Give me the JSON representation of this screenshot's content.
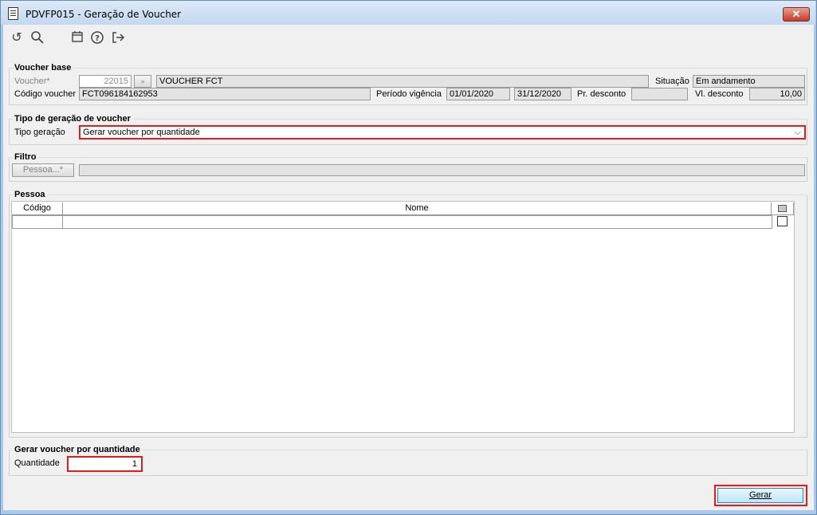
{
  "window": {
    "title": "PDVFP015 - Geração de Voucher",
    "close_label": "✕"
  },
  "toolbar": {
    "icons": [
      "refresh-icon",
      "search-icon",
      "calendar-icon",
      "help-icon",
      "exit-icon"
    ]
  },
  "voucher_base": {
    "title": "Voucher base",
    "voucher_label": "Voucher*",
    "voucher_value": "22015",
    "voucher_desc": "VOUCHER FCT",
    "situacao_label": "Situação",
    "situacao_value": "Em andamento",
    "codigo_label": "Código voucher",
    "codigo_value": "FCT096184162953",
    "periodo_label": "Período vigência",
    "periodo_inicio": "01/01/2020",
    "periodo_fim": "31/12/2020",
    "pr_desconto_label": "Pr. desconto",
    "pr_desconto_value": "",
    "vl_desconto_label": "Vl. desconto",
    "vl_desconto_value": "10,00"
  },
  "tipo_geracao": {
    "title": "Tipo de geração de voucher",
    "label": "Tipo geração",
    "selected": "Gerar voucher por quantidade"
  },
  "filtro": {
    "title": "Filtro",
    "pessoa_button": "Pessoa...*",
    "pessoa_value": ""
  },
  "pessoa": {
    "title": "Pessoa",
    "columns": [
      "Código",
      "Nome"
    ]
  },
  "quantidade": {
    "title": "Gerar voucher por quantidade",
    "label": "Quantidade",
    "value": "1"
  },
  "footer": {
    "gerar_label": "Gerar"
  }
}
